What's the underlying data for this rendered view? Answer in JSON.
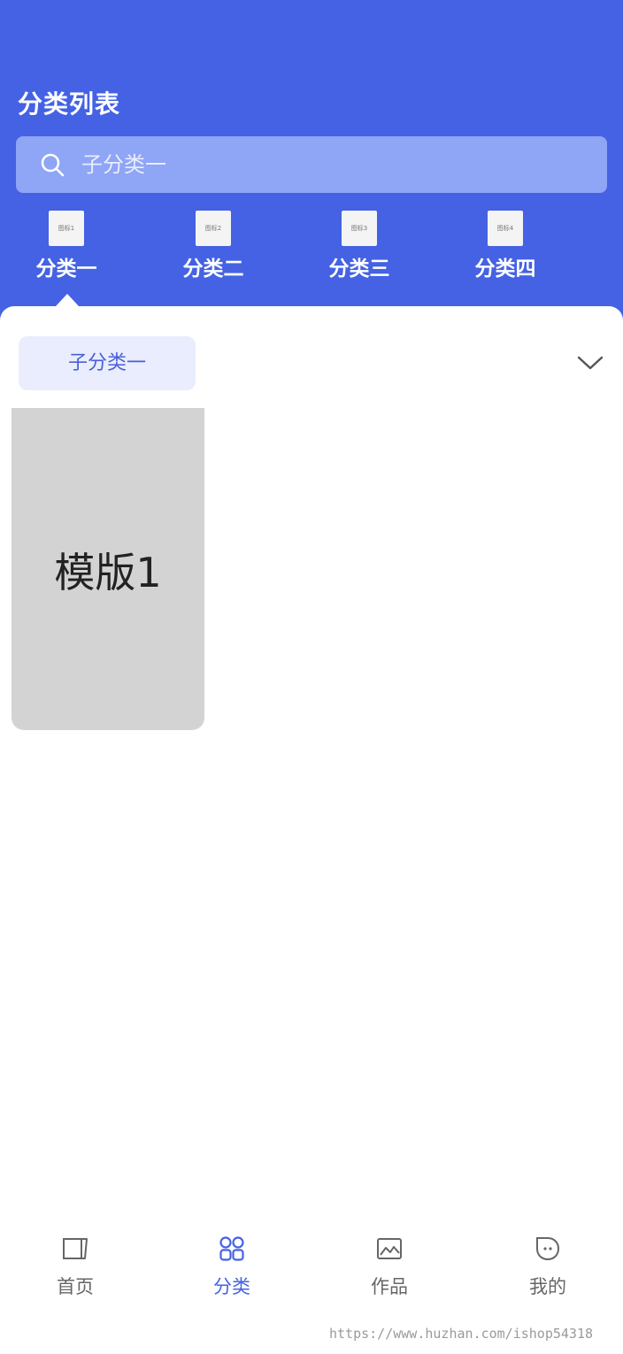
{
  "header": {
    "title": "分类列表",
    "background_color": "#4462e3"
  },
  "search": {
    "icon": "search-icon",
    "text": "子分类一"
  },
  "categories": [
    {
      "label": "分类一",
      "thumb_text": "图标1",
      "selected": true
    },
    {
      "label": "分类二",
      "thumb_text": "图标2",
      "selected": false
    },
    {
      "label": "分类三",
      "thumb_text": "图标3",
      "selected": false
    },
    {
      "label": "分类四",
      "thumb_text": "图标4",
      "selected": false
    }
  ],
  "subcategory": {
    "selected_label": "子分类一",
    "expand_icon": "chevron-down-icon"
  },
  "templates": [
    {
      "label": "模版1"
    }
  ],
  "tabbar": {
    "items": [
      {
        "label": "首页",
        "icon": "home-icon",
        "active": false
      },
      {
        "label": "分类",
        "icon": "category-grid-icon",
        "active": true
      },
      {
        "label": "作品",
        "icon": "image-icon",
        "active": false
      },
      {
        "label": "我的",
        "icon": "profile-icon",
        "active": false
      }
    ],
    "active_color": "#4462e3"
  },
  "watermark": "https://www.huzhan.com/ishop54318"
}
